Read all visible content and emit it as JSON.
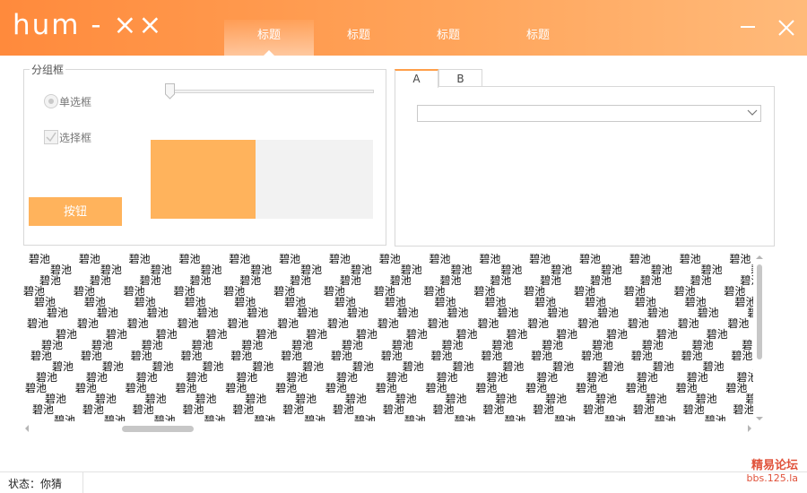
{
  "window": {
    "title": "hum - ××",
    "nav_tabs": [
      {
        "label": "标题",
        "active": true
      },
      {
        "label": "标题",
        "active": false
      },
      {
        "label": "标题",
        "active": false
      },
      {
        "label": "标题",
        "active": false
      }
    ],
    "accent_color": "#ff8a3c"
  },
  "groupbox": {
    "legend": "分组框",
    "radio_label": "单选框",
    "radio_checked": true,
    "checkbox_label": "选择框",
    "checkbox_checked": true,
    "button_label": "按钮",
    "slider_value": 0,
    "progress_fraction": 0.47,
    "progress_color": "#ffb35c"
  },
  "tab_control": {
    "tabs": [
      {
        "label": "A",
        "active": true
      },
      {
        "label": "B",
        "active": false
      }
    ],
    "combo_value": ""
  },
  "text_area": {
    "token": "碧池"
  },
  "status_bar": {
    "text": "状态：你猜"
  },
  "watermark": {
    "title": "精易论坛",
    "url": "bbs.125.la"
  }
}
